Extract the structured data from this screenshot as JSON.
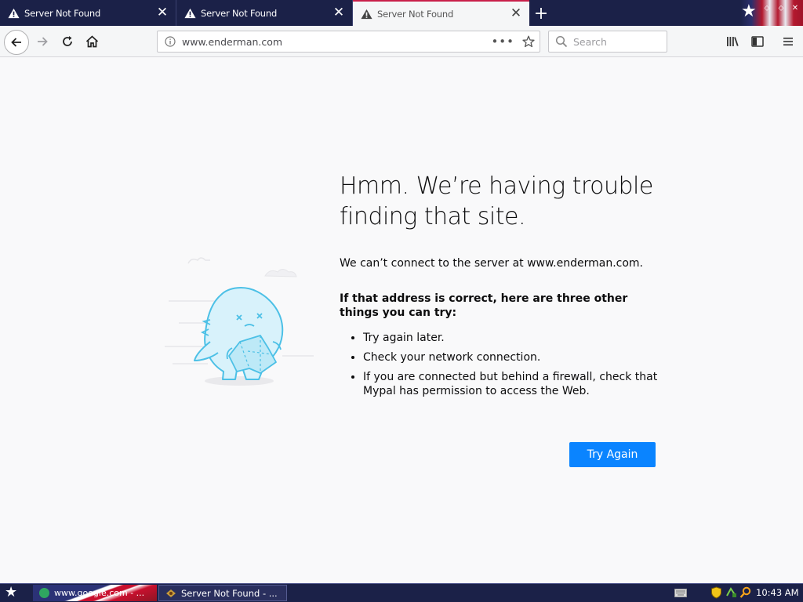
{
  "browser": {
    "tabs": [
      {
        "title": "Server Not Found",
        "selected": false
      },
      {
        "title": "Server Not Found",
        "selected": false
      },
      {
        "title": "Server Not Found",
        "selected": true
      }
    ],
    "url": "www.enderman.com",
    "search_placeholder": "Search"
  },
  "error_page": {
    "title": "Hmm. We’re having trouble finding that site.",
    "message": "We can’t connect to the server at www.enderman.com.",
    "suggestions_heading": "If that address is correct, here are three other things you can try:",
    "suggestions": [
      "Try again later.",
      "Check your network connection.",
      "If you are connected but behind a firewall, check that Mypal has permission to access the Web."
    ],
    "button_label": "Try Again"
  },
  "taskbar": {
    "items": [
      {
        "label": "www.google.com - ..."
      },
      {
        "label": "Server Not Found - ..."
      }
    ],
    "clock": "10:43 AM"
  },
  "colors": {
    "tabstrip": "#1b2148",
    "accent_button": "#0a84ff",
    "selected_tab_line": "#c9204a"
  }
}
